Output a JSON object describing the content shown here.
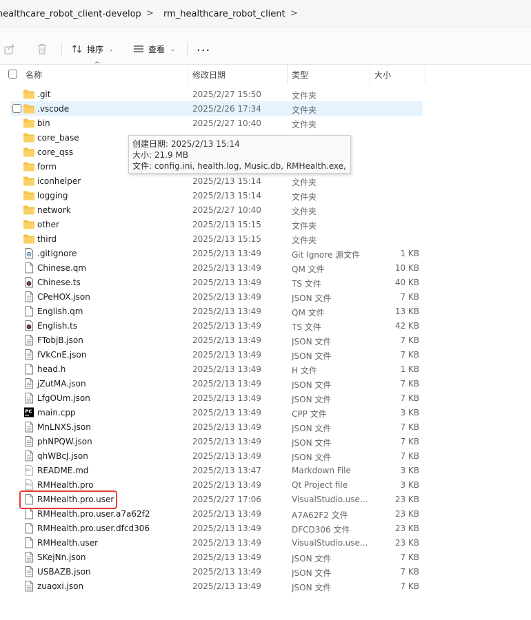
{
  "breadcrumb": {
    "items": [
      "healthcare_robot_client-develop",
      "rm_healthcare_robot_client"
    ],
    "separator": ">"
  },
  "toolbar": {
    "sort_label": "排序",
    "view_label": "查看",
    "more_label": "..."
  },
  "columns": {
    "name": "名称",
    "date": "修改日期",
    "type": "类型",
    "size": "大小"
  },
  "tooltip": {
    "created": "创建日期: 2025/2/13 15:14",
    "size": "大小: 21.9 MB",
    "files": "文件: config.ini, health.log, Music.db, RMHealth.exe, ..."
  },
  "files": [
    {
      "name": ".git",
      "date": "2025/2/27 15:50",
      "type": "文件夹",
      "size": "",
      "icon": "folder-icon"
    },
    {
      "name": ".vscode",
      "date": "2025/2/26 17:34",
      "type": "文件夹",
      "size": "",
      "icon": "folder-icon"
    },
    {
      "name": "bin",
      "date": "2025/2/27 10:40",
      "type": "文件夹",
      "size": "",
      "icon": "folder-icon"
    },
    {
      "name": "core_base",
      "date": "",
      "type": "",
      "size": "",
      "icon": "folder-icon"
    },
    {
      "name": "core_qss",
      "date": "",
      "type": "",
      "size": "",
      "icon": "folder-icon"
    },
    {
      "name": "form",
      "date": "",
      "type": "",
      "size": "",
      "icon": "folder-icon"
    },
    {
      "name": "iconhelper",
      "date": "2025/2/13 15:14",
      "type": "文件夹",
      "size": "",
      "icon": "folder-icon"
    },
    {
      "name": "logging",
      "date": "2025/2/13 15:14",
      "type": "文件夹",
      "size": "",
      "icon": "folder-icon"
    },
    {
      "name": "network",
      "date": "2025/2/27 10:40",
      "type": "文件夹",
      "size": "",
      "icon": "folder-icon"
    },
    {
      "name": "other",
      "date": "2025/2/13 15:15",
      "type": "文件夹",
      "size": "",
      "icon": "folder-icon"
    },
    {
      "name": "third",
      "date": "2025/2/13 15:15",
      "type": "文件夹",
      "size": "",
      "icon": "folder-icon"
    },
    {
      "name": ".gitignore",
      "date": "2025/2/13 13:49",
      "type": "Git Ignore 源文件",
      "size": "1 KB",
      "icon": "gear-file-icon"
    },
    {
      "name": "Chinese.qm",
      "date": "2025/2/13 13:49",
      "type": "QM 文件",
      "size": "10 KB",
      "icon": "file-icon"
    },
    {
      "name": "Chinese.ts",
      "date": "2025/2/13 13:49",
      "type": "TS 文件",
      "size": "40 KB",
      "icon": "media-file-icon"
    },
    {
      "name": "CPeHOX.json",
      "date": "2025/2/13 13:49",
      "type": "JSON 文件",
      "size": "7 KB",
      "icon": "text-file-icon"
    },
    {
      "name": "English.qm",
      "date": "2025/2/13 13:49",
      "type": "QM 文件",
      "size": "13 KB",
      "icon": "file-icon"
    },
    {
      "name": "English.ts",
      "date": "2025/2/13 13:49",
      "type": "TS 文件",
      "size": "42 KB",
      "icon": "media-file-icon"
    },
    {
      "name": "FTobjB.json",
      "date": "2025/2/13 13:49",
      "type": "JSON 文件",
      "size": "7 KB",
      "icon": "text-file-icon"
    },
    {
      "name": "fVkCnE.json",
      "date": "2025/2/13 13:49",
      "type": "JSON 文件",
      "size": "7 KB",
      "icon": "text-file-icon"
    },
    {
      "name": "head.h",
      "date": "2025/2/13 13:49",
      "type": "H 文件",
      "size": "1 KB",
      "icon": "file-icon"
    },
    {
      "name": "jZutMA.json",
      "date": "2025/2/13 13:49",
      "type": "JSON 文件",
      "size": "7 KB",
      "icon": "text-file-icon"
    },
    {
      "name": "LfgOUm.json",
      "date": "2025/2/13 13:49",
      "type": "JSON 文件",
      "size": "7 KB",
      "icon": "text-file-icon"
    },
    {
      "name": "main.cpp",
      "date": "2025/2/13 13:49",
      "type": "CPP 文件",
      "size": "3 KB",
      "icon": "pycharm-file-icon"
    },
    {
      "name": "MnLNXS.json",
      "date": "2025/2/13 13:49",
      "type": "JSON 文件",
      "size": "7 KB",
      "icon": "text-file-icon"
    },
    {
      "name": "phNPQW.json",
      "date": "2025/2/13 13:49",
      "type": "JSON 文件",
      "size": "7 KB",
      "icon": "text-file-icon"
    },
    {
      "name": "qhWBcJ.json",
      "date": "2025/2/13 13:49",
      "type": "JSON 文件",
      "size": "7 KB",
      "icon": "text-file-icon"
    },
    {
      "name": "README.md",
      "date": "2025/2/13 13:47",
      "type": "Markdown File",
      "size": "3 KB",
      "icon": "markdown-file-icon"
    },
    {
      "name": "RMHealth.pro",
      "date": "2025/2/13 13:49",
      "type": "Qt Project file",
      "size": "3 KB",
      "icon": "pro-file-icon"
    },
    {
      "name": "RMHealth.pro.user",
      "date": "2025/2/27 17:06",
      "type": "VisualStudio.use...",
      "size": "23 KB",
      "icon": "file-icon"
    },
    {
      "name": "RMHealth.pro.user.a7a62f2",
      "date": "2025/2/13 13:49",
      "type": "A7A62F2 文件",
      "size": "23 KB",
      "icon": "file-icon"
    },
    {
      "name": "RMHealth.pro.user.dfcd306",
      "date": "2025/2/13 13:49",
      "type": "DFCD306 文件",
      "size": "23 KB",
      "icon": "file-icon"
    },
    {
      "name": "RMHealth.user",
      "date": "2025/2/13 13:49",
      "type": "VisualStudio.use...",
      "size": "23 KB",
      "icon": "file-icon"
    },
    {
      "name": "SKejNn.json",
      "date": "2025/2/13 13:49",
      "type": "JSON 文件",
      "size": "7 KB",
      "icon": "text-file-icon"
    },
    {
      "name": "USBAZB.json",
      "date": "2025/2/13 13:49",
      "type": "JSON 文件",
      "size": "7 KB",
      "icon": "text-file-icon"
    },
    {
      "name": "zuaoxi.json",
      "date": "2025/2/13 13:49",
      "type": "JSON 文件",
      "size": "7 KB",
      "icon": "text-file-icon"
    }
  ],
  "colors": {
    "folder": "#f6c244",
    "hover_row": "#e5f3ff",
    "highlight_box": "#e83a2f"
  }
}
